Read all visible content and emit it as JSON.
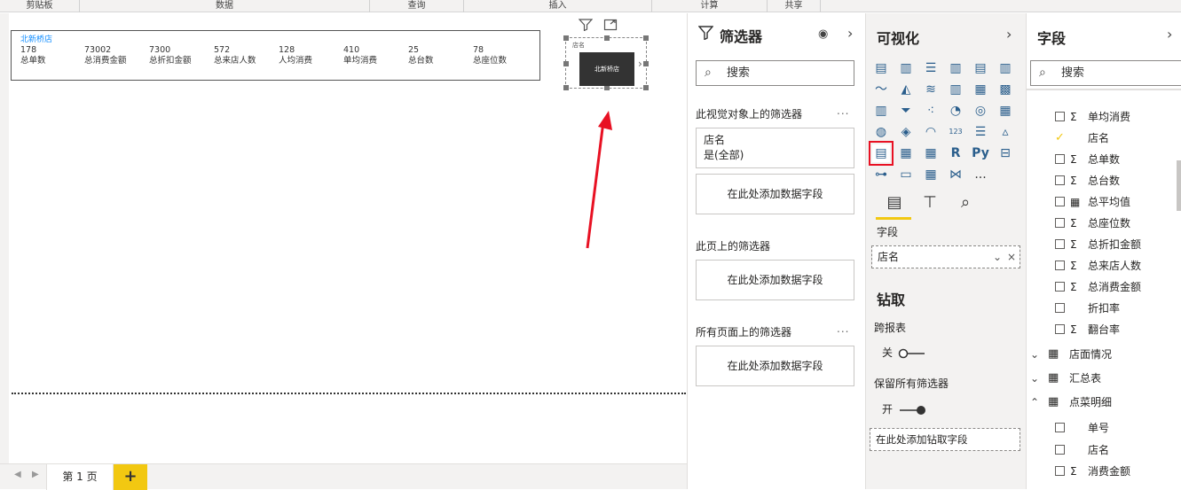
{
  "ribbon": {
    "groups": [
      "剪贴板",
      "数据",
      "查询",
      "插入",
      "计算",
      "共享"
    ]
  },
  "canvas": {
    "card": {
      "title": "北新桥店",
      "metrics": [
        {
          "value": "178",
          "label": "总单数"
        },
        {
          "value": "73002",
          "label": "总消费金额"
        },
        {
          "value": "7300",
          "label": "总折扣金额"
        },
        {
          "value": "572",
          "label": "总来店人数"
        },
        {
          "value": "128",
          "label": "人均消费"
        },
        {
          "value": "410",
          "label": "单均消费"
        },
        {
          "value": "25",
          "label": "总台数"
        },
        {
          "value": "78",
          "label": "总座位数"
        }
      ]
    },
    "slicer": {
      "header": "店名",
      "tile": "北新桥店"
    }
  },
  "pages": {
    "tabs": [
      "第 1 页"
    ],
    "add_label": "+"
  },
  "filters": {
    "title": "筛选器",
    "search_placeholder": "搜索",
    "visual_section": "此视觉对象上的筛选器",
    "card_field": "店名",
    "card_value": "是(全部)",
    "drop_hint": "在此处添加数据字段",
    "page_section": "此页上的筛选器",
    "all_pages_section": "所有页面上的筛选器",
    "more": "..."
  },
  "viz": {
    "title": "可视化",
    "more_visuals": "...",
    "r_label": "R",
    "py_label": "Py",
    "fields_label": "字段",
    "field_value": "店名",
    "drill_title": "钻取",
    "cross_report": "跨报表",
    "cross_state": "关",
    "keep_filters": "保留所有筛选器",
    "keep_state": "开",
    "drill_hint": "在此处添加钻取字段"
  },
  "fields": {
    "title": "字段",
    "search_placeholder": "搜索",
    "items": [
      {
        "name": "单均消费",
        "checked": false,
        "sigma": true
      },
      {
        "name": "店名",
        "checked": true,
        "sigma": false
      },
      {
        "name": "总单数",
        "checked": false,
        "sigma": true
      },
      {
        "name": "总台数",
        "checked": false,
        "sigma": true
      },
      {
        "name": "总平均值",
        "checked": false,
        "sigma": false,
        "calc": true
      },
      {
        "name": "总座位数",
        "checked": false,
        "sigma": true
      },
      {
        "name": "总折扣金额",
        "checked": false,
        "sigma": true
      },
      {
        "name": "总来店人数",
        "checked": false,
        "sigma": true
      },
      {
        "name": "总消费金额",
        "checked": false,
        "sigma": true
      },
      {
        "name": "折扣率",
        "checked": false,
        "sigma": false
      },
      {
        "name": "翻台率",
        "checked": false,
        "sigma": true
      }
    ],
    "tables": [
      "店面情况",
      "汇总表",
      "点菜明细"
    ],
    "detail_items": [
      {
        "name": "单号",
        "checked": false,
        "sigma": false
      },
      {
        "name": "店名",
        "checked": false,
        "sigma": false
      },
      {
        "name": "消费金额",
        "checked": false,
        "sigma": true
      }
    ]
  },
  "colors": {
    "accent_yellow": "#f2c811",
    "highlight_red": "#e81123",
    "link_blue": "#118dff"
  }
}
